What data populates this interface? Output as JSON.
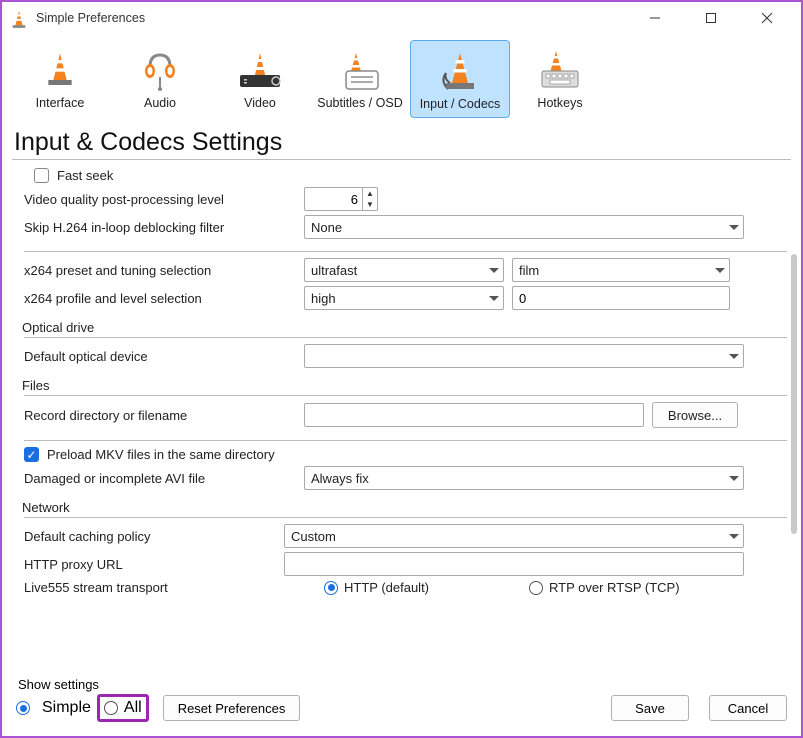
{
  "window": {
    "title": "Simple Preferences"
  },
  "tabs": {
    "interface": "Interface",
    "audio": "Audio",
    "video": "Video",
    "subtitles": "Subtitles / OSD",
    "input_codecs": "Input / Codecs",
    "hotkeys": "Hotkeys"
  },
  "page_title": "Input & Codecs Settings",
  "codecs": {
    "fast_seek_label": "Fast seek",
    "video_quality_label": "Video quality post-processing level",
    "video_quality_value": "6",
    "skip_h264_label": "Skip H.264 in-loop deblocking filter",
    "skip_h264_value": "None",
    "x264_preset_label": "x264 preset and tuning selection",
    "x264_preset_value": "ultrafast",
    "x264_tuning_value": "film",
    "x264_profile_label": "x264 profile and level selection",
    "x264_profile_value": "high",
    "x264_level_value": "0"
  },
  "optical": {
    "group": "Optical drive",
    "default_device_label": "Default optical device",
    "default_device_value": ""
  },
  "files": {
    "group": "Files",
    "record_label": "Record directory or filename",
    "record_value": "",
    "browse": "Browse...",
    "preload_mkv_label": "Preload MKV files in the same directory",
    "damaged_avi_label": "Damaged or incomplete AVI file",
    "damaged_avi_value": "Always fix"
  },
  "network": {
    "group": "Network",
    "caching_label": "Default caching policy",
    "caching_value": "Custom",
    "proxy_label": "HTTP proxy URL",
    "proxy_value": "",
    "live555_label": "Live555 stream transport",
    "http_default": "HTTP (default)",
    "rtp_over_rtsp": "RTP over RTSP (TCP)"
  },
  "footer": {
    "show_settings": "Show settings",
    "simple": "Simple",
    "all": "All",
    "reset": "Reset Preferences",
    "save": "Save",
    "cancel": "Cancel"
  }
}
